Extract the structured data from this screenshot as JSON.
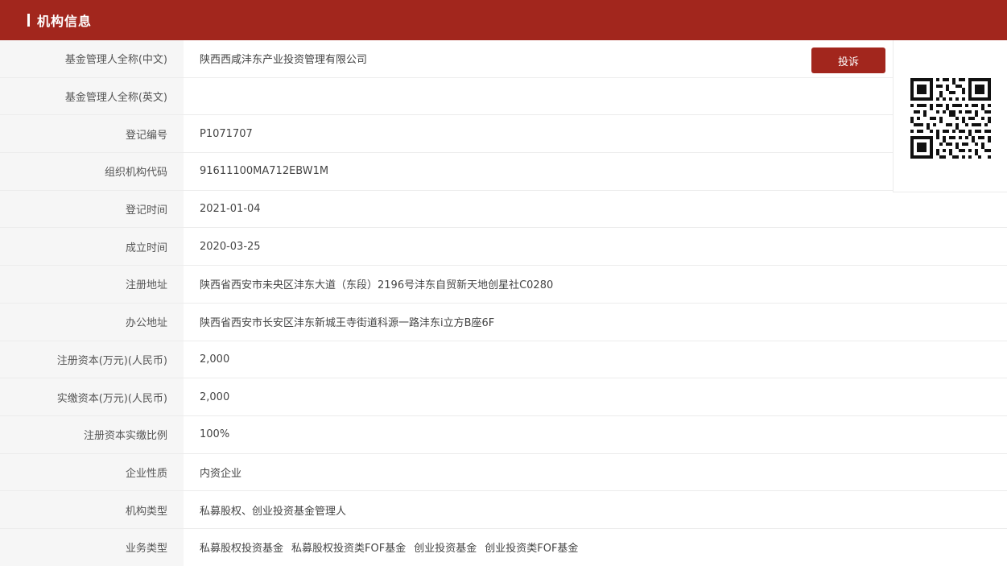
{
  "header": {
    "title": "机构信息"
  },
  "complaint_button": "投诉",
  "rows": [
    {
      "label": "基金管理人全称(中文)",
      "value": "陕西西咸沣东产业投资管理有限公司"
    },
    {
      "label": "基金管理人全称(英文)",
      "value": ""
    },
    {
      "label": "登记编号",
      "value": "P1071707"
    },
    {
      "label": "组织机构代码",
      "value": "91611100MA712EBW1M"
    },
    {
      "label": "登记时间",
      "value": "2021-01-04"
    },
    {
      "label": "成立时间",
      "value": "2020-03-25"
    },
    {
      "label": "注册地址",
      "value": "陕西省西安市未央区沣东大道（东段）2196号沣东自贸新天地创星社C0280"
    },
    {
      "label": "办公地址",
      "value": "陕西省西安市长安区沣东新城王寺街道科源一路沣东i立方B座6F"
    },
    {
      "label": "注册资本(万元)(人民币)",
      "value": "2,000"
    },
    {
      "label": "实缴资本(万元)(人民币)",
      "value": "2,000"
    },
    {
      "label": "注册资本实缴比例",
      "value": "100%"
    },
    {
      "label": "企业性质",
      "value": "内资企业"
    },
    {
      "label": "机构类型",
      "value": "私募股权、创业投资基金管理人"
    }
  ],
  "business_type": {
    "label": "业务类型",
    "items": [
      "私募股权投资基金",
      "私募股权投资类FOF基金",
      "创业投资基金",
      "创业投资类FOF基金"
    ]
  },
  "colors": {
    "brand": "#a2261d",
    "label_bg": "#f6f6f6",
    "border": "#ececec"
  },
  "icons": {
    "qr": "qr-code-icon"
  }
}
